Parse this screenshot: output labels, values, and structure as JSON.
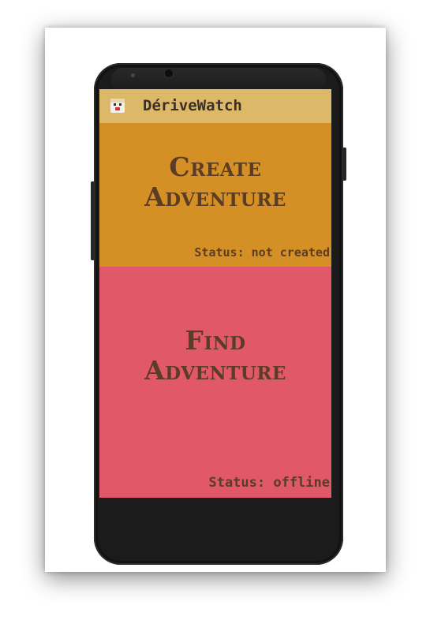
{
  "app": {
    "title": "DériveWatch",
    "icon": "app-logo-icon"
  },
  "create_panel": {
    "heading_line1": "Create",
    "heading_line2": "Adventure",
    "status": "Status: not created",
    "color": "#d59025"
  },
  "find_panel": {
    "heading_line1": "Find",
    "heading_line2": "Adventure",
    "status": "Status: offline",
    "color": "#e0586a"
  },
  "colors": {
    "action_bar": "#dcb968",
    "text": "#5b3c24",
    "phone_body": "#1b1b1b"
  }
}
